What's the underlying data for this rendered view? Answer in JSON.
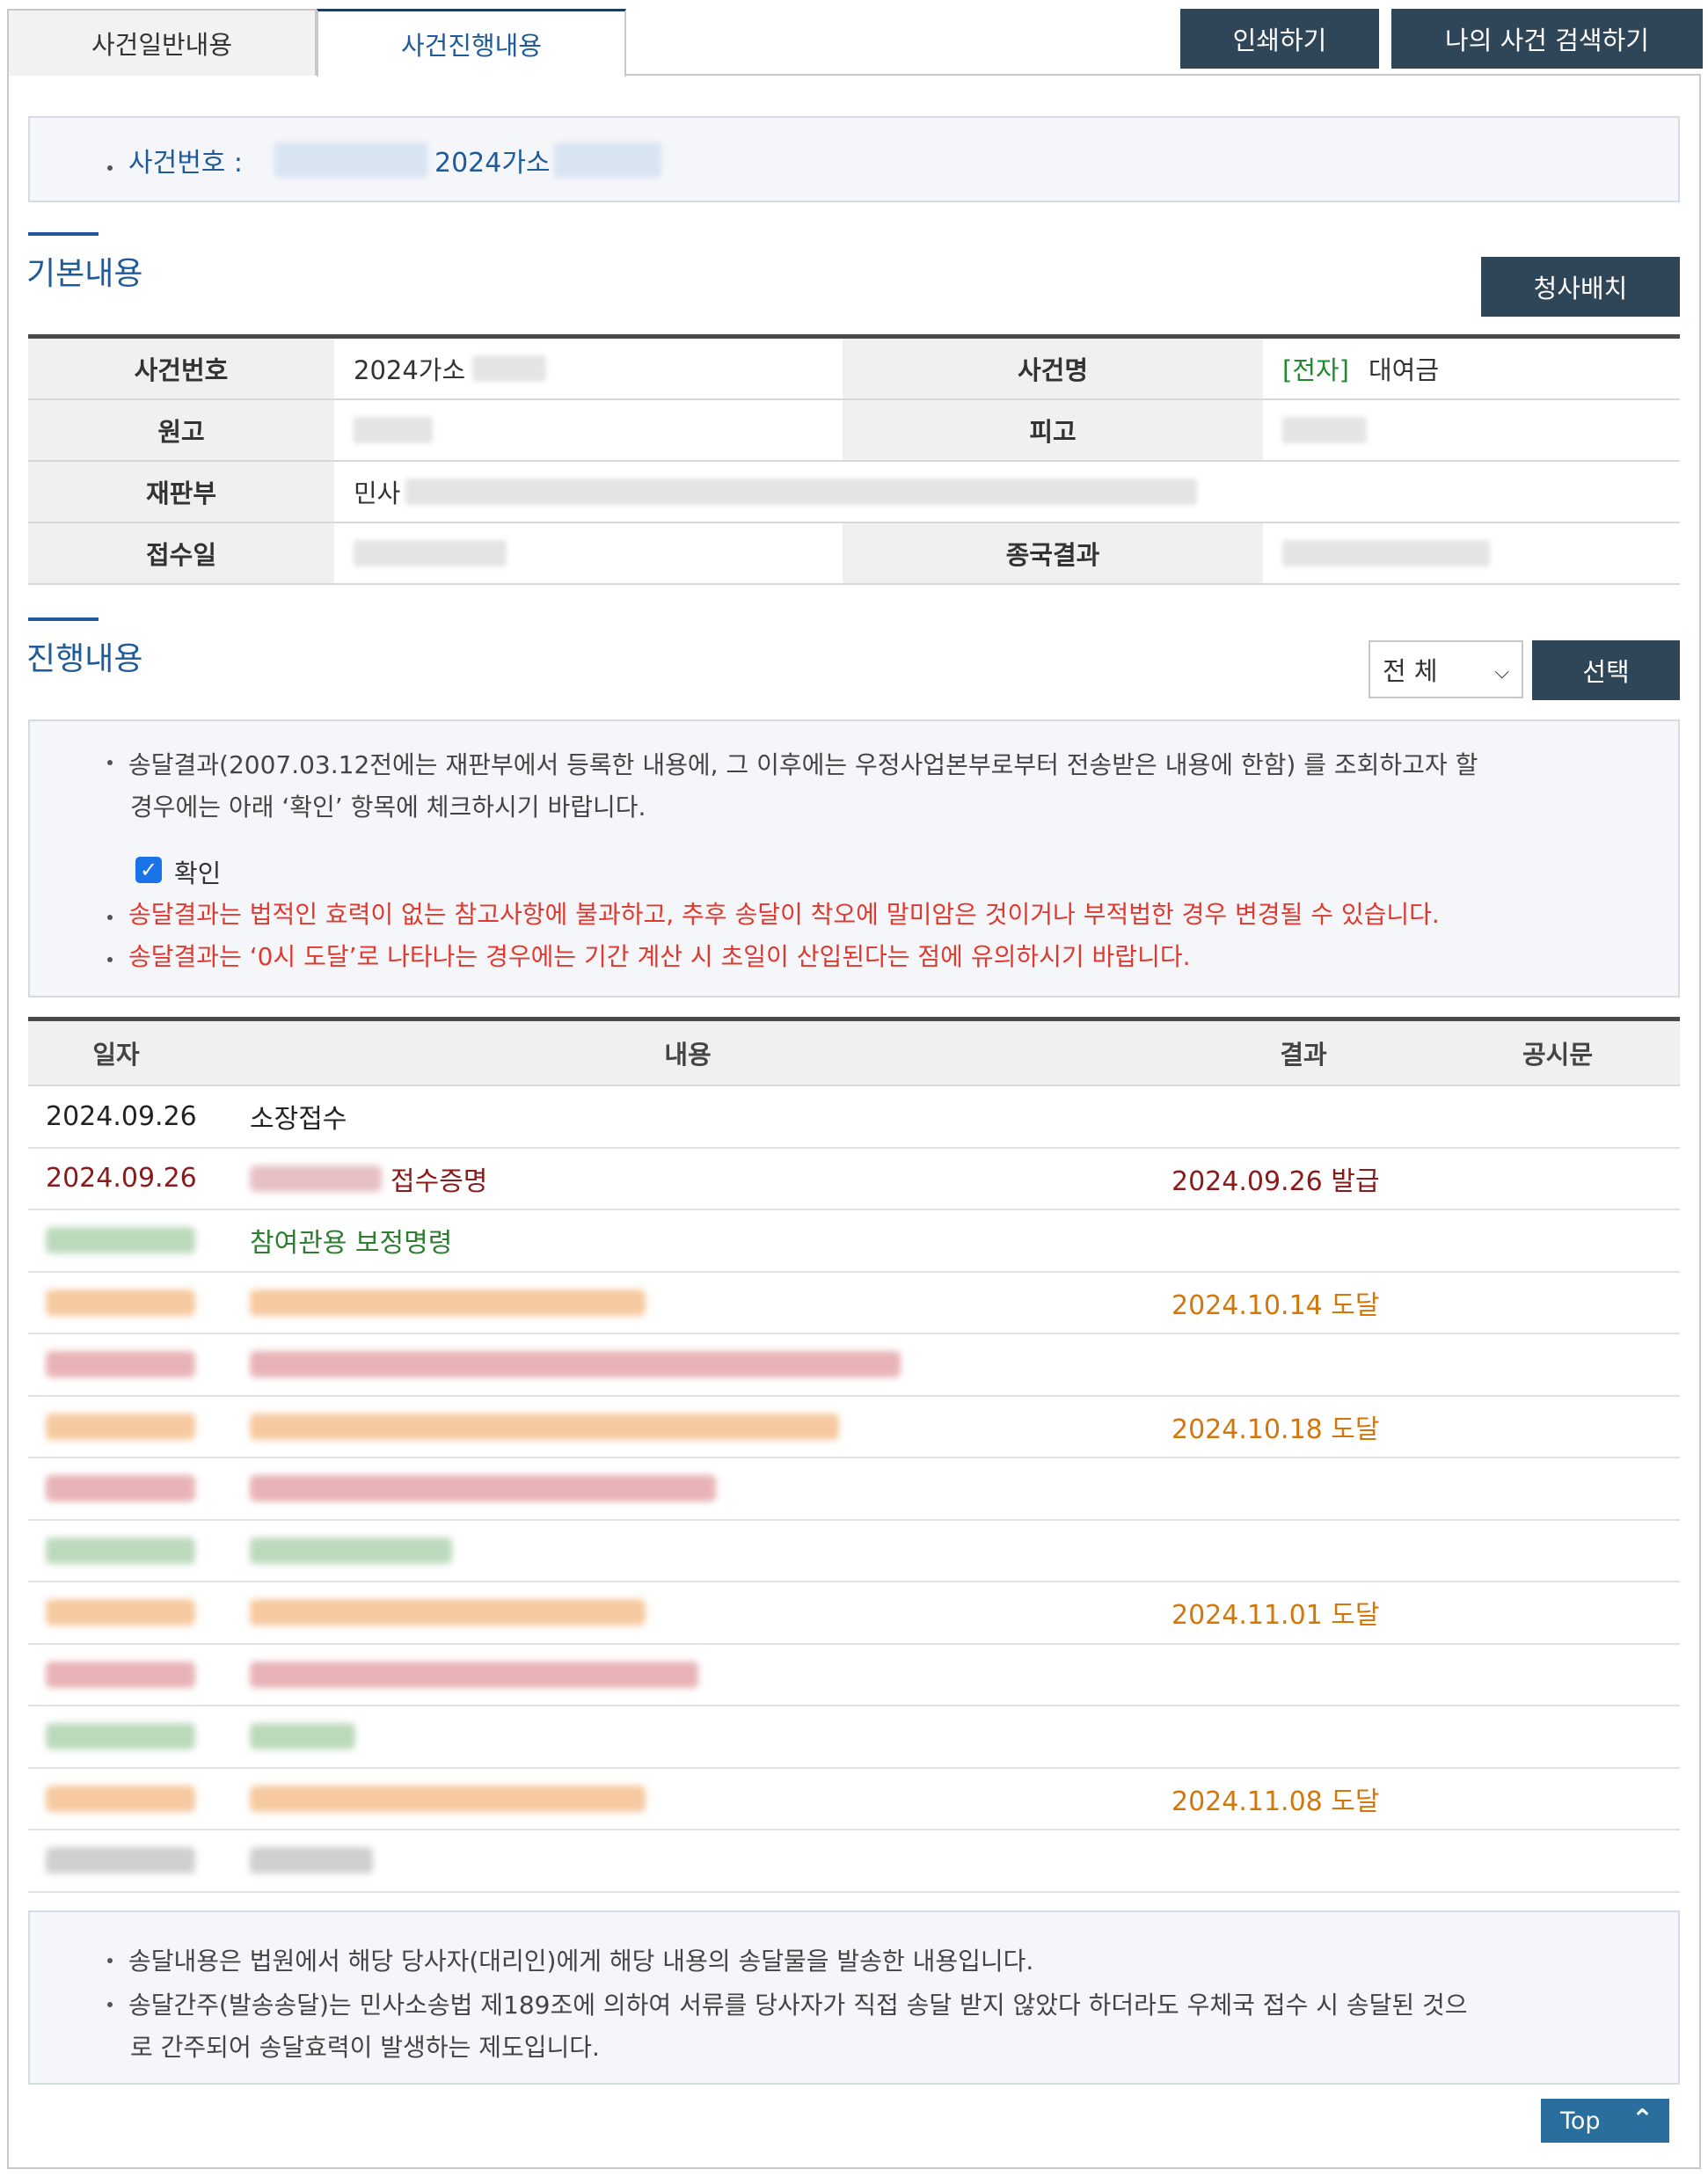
{
  "tabs": {
    "general": "사건일반내용",
    "progress": "사건진행내용"
  },
  "toolbar": {
    "print": "인쇄하기",
    "my_case_search": "나의 사건 검색하기"
  },
  "case_header": {
    "label": "사건번호 :",
    "number": "2024가소"
  },
  "basic": {
    "title": "기본내용",
    "courthouse_button": "청사배치",
    "rows": {
      "case_no_label": "사건번호",
      "case_no_value": "2024가소",
      "case_name_label": "사건명",
      "case_name_tag": "[전자]",
      "case_name_value": "대여금",
      "plaintiff_label": "원고",
      "defendant_label": "피고",
      "division_label": "재판부",
      "division_value": "민사",
      "received_label": "접수일",
      "result_label": "종국결과"
    }
  },
  "progress": {
    "title": "진행내용",
    "filter_value": "전 체",
    "select_button": "선택",
    "notice": {
      "line1": "송달결과(2007.03.12전에는 재판부에서 등록한 내용에, 그 이후에는 우정사업본부로부터 전송받은 내용에 한함) 를 조회하고자 할",
      "line1b": "경우에는 아래 ‘확인’ 항목에 체크하시기 바랍니다.",
      "confirm_label": "확인",
      "warning1": "송달결과는 법적인 효력이 없는 참고사항에 불과하고, 추후 송달이 착오에 말미암은 것이거나 부적법한 경우 변경될 수 있습니다.",
      "warning2": "송달결과는 ‘0시 도달’로 나타나는 경우에는 기간 계산 시 초일이 산입된다는 점에 유의하시기 바랍니다."
    },
    "columns": {
      "date": "일자",
      "content": "내용",
      "result": "결과",
      "notice": "공시문"
    },
    "rows": [
      {
        "date": "2024.09.26",
        "content": "소장접수",
        "result": ""
      },
      {
        "date": "2024.09.26",
        "content": "접수증명",
        "result": "2024.09.26 발급"
      },
      {
        "date": "",
        "content": "참여관용 보정명령",
        "result": ""
      },
      {
        "date": "",
        "content": "",
        "result": "2024.10.14 도달"
      },
      {
        "date": "",
        "content": "",
        "result": ""
      },
      {
        "date": "",
        "content": "",
        "result": "2024.10.18 도달"
      },
      {
        "date": "",
        "content": "",
        "result": ""
      },
      {
        "date": "",
        "content": "",
        "result": ""
      },
      {
        "date": "",
        "content": "",
        "result": "2024.11.01 도달"
      },
      {
        "date": "",
        "content": "",
        "result": ""
      },
      {
        "date": "",
        "content": "",
        "result": ""
      },
      {
        "date": "",
        "content": "",
        "result": "2024.11.08 도달"
      },
      {
        "date": "",
        "content": "",
        "result": ""
      }
    ]
  },
  "bottom_notice": {
    "line1": "송달내용은 법원에서 해당 당사자(대리인)에게 해당 내용의 송달물을 발송한 내용입니다.",
    "line2": "송달간주(발송송달)는 민사소송법 제189조에 의하여 서류를 당사자가 직접 송달 받지 않았다 하더라도 우체국 접수 시 송달된 것으",
    "line2b": "로 간주되어 송달효력이 발생하는 제도입니다."
  },
  "top_button": "Top",
  "colors": {
    "navy_button": "#2f4558",
    "heading_blue": "#1f5a9a",
    "warning_red": "#e0392f",
    "result_orange": "#d4760a",
    "tag_green": "#1f8a2e"
  }
}
